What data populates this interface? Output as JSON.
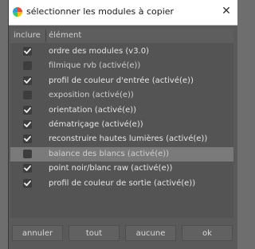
{
  "window": {
    "title": "sélectionner les modules à copier",
    "close_glyph": "✕"
  },
  "table": {
    "header_include": "inclure",
    "header_element": "élément",
    "rows": [
      {
        "label": "ordre des modules (v3.0)",
        "checked": true
      },
      {
        "label": "filmique rvb  (activé(e))",
        "checked": false
      },
      {
        "label": "profil de couleur d'entrée  (activé(e))",
        "checked": true
      },
      {
        "label": "exposition  (activé(e))",
        "checked": false
      },
      {
        "label": "orientation  (activé(e))",
        "checked": true
      },
      {
        "label": "dématriçage  (activé(e))",
        "checked": true
      },
      {
        "label": "reconstruire hautes lumières  (activé(e))",
        "checked": true
      },
      {
        "label": "balance des blancs  (activé(e))",
        "checked": false,
        "selected": true
      },
      {
        "label": "point noir/blanc raw  (activé(e))",
        "checked": true
      },
      {
        "label": "profil de couleur de sortie  (activé(e))",
        "checked": true
      }
    ]
  },
  "buttons": {
    "cancel": "annuler",
    "all": "tout",
    "none": "aucune",
    "ok": "ok"
  },
  "icons": {
    "app": "darktable-icon",
    "check": "check-icon"
  },
  "colors": {
    "check_mark": "#f0f0f0",
    "selected_row": "#7a7a7a"
  }
}
